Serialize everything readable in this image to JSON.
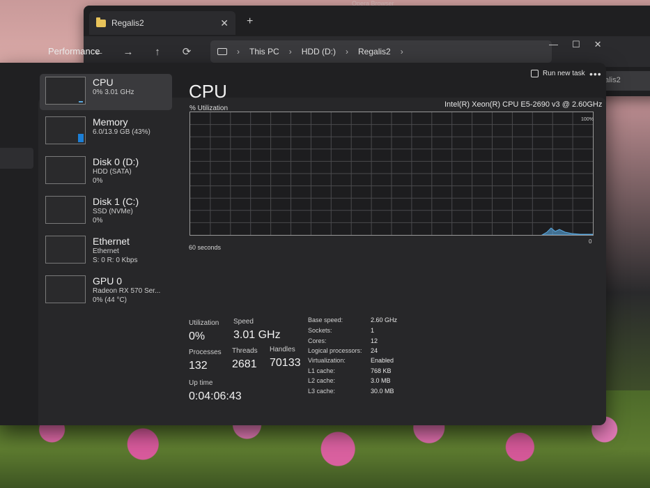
{
  "wallpaper": {
    "label": "Opera Browser"
  },
  "explorer": {
    "tab_title": "Regalis2",
    "close": "✕",
    "new_tab": "+",
    "nav": [
      "←",
      "→",
      "↑",
      "⟳"
    ],
    "breadcrumb": [
      "This PC",
      "HDD (D:)",
      "Regalis2"
    ],
    "search_placeholder": "Search Regalis2"
  },
  "taskmgr": {
    "title": "Performance",
    "window_controls": [
      "—",
      "☐",
      "✕"
    ],
    "run_new_task": "Run new task",
    "more": "•••",
    "sidebar": [
      {
        "name": "CPU",
        "sub1": "0% 3.01 GHz",
        "sub2": "",
        "sub3": ""
      },
      {
        "name": "Memory",
        "sub1": "6.0/13.9 GB (43%)",
        "sub2": "",
        "sub3": ""
      },
      {
        "name": "Disk 0 (D:)",
        "sub1": "HDD (SATA)",
        "sub2": "0%",
        "sub3": ""
      },
      {
        "name": "Disk 1 (C:)",
        "sub1": "SSD (NVMe)",
        "sub2": "0%",
        "sub3": ""
      },
      {
        "name": "Ethernet",
        "sub1": "Ethernet",
        "sub2": "S: 0 R: 0 Kbps",
        "sub3": ""
      },
      {
        "name": "GPU 0",
        "sub1": "Radeon RX 570 Ser...",
        "sub2": "0% (44 °C)",
        "sub3": ""
      }
    ],
    "main": {
      "title": "CPU",
      "util_label": "% Utilization",
      "cpu_model": "Intel(R) Xeon(R) CPU E5-2690 v3 @ 2.60GHz",
      "max_pct": "100%",
      "seconds": "60 seconds",
      "zero": "0"
    },
    "stats": {
      "utilization_label": "Utilization",
      "utilization": "0%",
      "speed_label": "Speed",
      "speed": "3.01 GHz",
      "processes_label": "Processes",
      "processes": "132",
      "threads_label": "Threads",
      "threads": "2681",
      "handles_label": "Handles",
      "handles": "70133",
      "uptime_label": "Up time",
      "uptime": "0:04:06:43"
    },
    "specs": [
      {
        "k": "Base speed:",
        "v": "2.60 GHz"
      },
      {
        "k": "Sockets:",
        "v": "1"
      },
      {
        "k": "Cores:",
        "v": "12"
      },
      {
        "k": "Logical processors:",
        "v": "24"
      },
      {
        "k": "Virtualization:",
        "v": "Enabled"
      },
      {
        "k": "L1 cache:",
        "v": "768 KB"
      },
      {
        "k": "L2 cache:",
        "v": "3.0 MB"
      },
      {
        "k": "L3 cache:",
        "v": "30.0 MB"
      }
    ],
    "graph": {
      "grid_cols": 20,
      "grid_rows": 10,
      "accent": "#5aa9e0"
    }
  }
}
